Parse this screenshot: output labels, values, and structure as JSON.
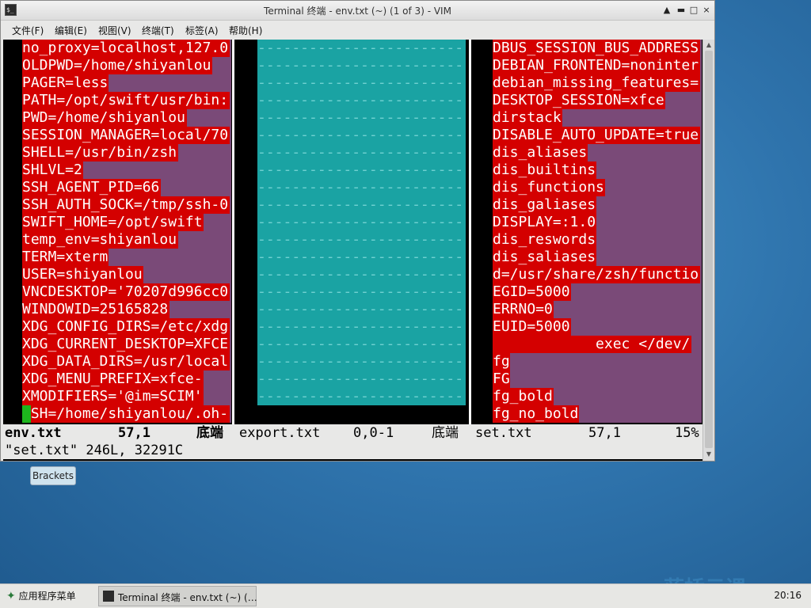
{
  "window": {
    "title": "Terminal 终端 - env.txt (~) (1 of 3) - VIM",
    "app_icon_glyph": "$_",
    "btn_shade": "▲",
    "btn_min": "▬",
    "btn_max": "□",
    "btn_close": "×"
  },
  "menu": [
    {
      "label": "文件(F)"
    },
    {
      "label": "编辑(E)"
    },
    {
      "label": "视图(V)"
    },
    {
      "label": "终端(T)"
    },
    {
      "label": "标签(A)"
    },
    {
      "label": "帮助(H)"
    }
  ],
  "left_pane": [
    "no_proxy=localhost,127.0",
    "OLDPWD=/home/shiyanlou",
    "PAGER=less",
    "PATH=/opt/swift/usr/bin:",
    "PWD=/home/shiyanlou",
    "SESSION_MANAGER=local/70",
    "SHELL=/usr/bin/zsh",
    "SHLVL=2",
    "SSH_AGENT_PID=66",
    "SSH_AUTH_SOCK=/tmp/ssh-0",
    "SWIFT_HOME=/opt/swift",
    "temp_env=shiyanlou",
    "TERM=xterm",
    "USER=shiyanlou",
    "VNCDESKTOP='70207d996cc0",
    "WINDOWID=25165828",
    "XDG_CONFIG_DIRS=/etc/xdg",
    "XDG_CURRENT_DESKTOP=XFCE",
    "XDG_DATA_DIRS=/usr/local",
    "XDG_MENU_PREFIX=xfce-",
    "XMODIFIERS='@im=SCIM'",
    "ZSH=/home/shiyanlou/.oh-"
  ],
  "right_pane": [
    "DBUS_SESSION_BUS_ADDRESS",
    "DEBIAN_FRONTEND=noninter",
    "debian_missing_features=",
    "DESKTOP_SESSION=xfce",
    "dirstack",
    "DISABLE_AUTO_UPDATE=true",
    "dis_aliases",
    "dis_builtins",
    "dis_functions",
    "dis_galiases",
    "DISPLAY=:1.0",
    "dis_reswords",
    "dis_saliases",
    "d=/usr/share/zsh/functio",
    "EGID=5000",
    "ERRNO=0",
    "EUID=5000",
    "            exec </dev/",
    "fg",
    "FG",
    "fg_bold",
    "fg_no_bold"
  ],
  "mid_dash": "-------------------------",
  "status": {
    "left_name": "env.txt",
    "left_pos": "57,1",
    "left_where": "底端",
    "mid_name": "export.txt",
    "mid_pos": "0,0-1",
    "mid_where": "底端",
    "right_name": "set.txt",
    "right_pos": "57,1",
    "right_pct": "15%"
  },
  "cmdline": "\"set.txt\" 246L, 32291C",
  "tooltip": "Brackets",
  "taskbar": {
    "apps_menu": "应用程序菜单",
    "task_label": "Terminal 终端 - env.txt (~) (…",
    "clock": "20:16"
  },
  "watermark": "蓝桥云课",
  "colors": {
    "highlight": "#d40000",
    "pane_bg": "#7a4a78",
    "mid_bg": "#1aa3a3",
    "cursor": "#1db51d"
  }
}
